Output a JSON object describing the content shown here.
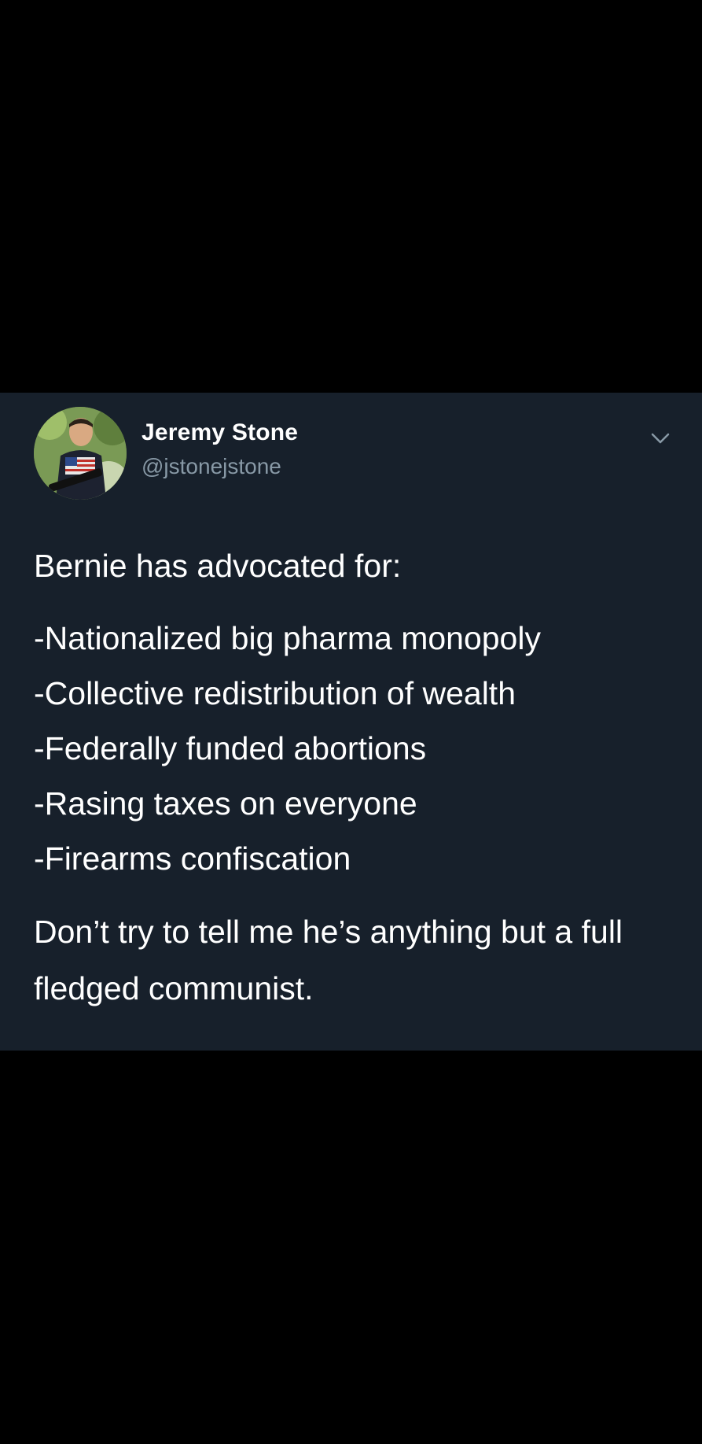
{
  "tweet": {
    "author": {
      "name": "Jeremy Stone",
      "handle": "@jstonejstone"
    },
    "icons": {
      "more": "chevron-down-icon",
      "avatar": "profile-photo"
    },
    "text": {
      "intro": "Bernie has advocated for:",
      "items": [
        "-Nationalized big pharma monopoly",
        "-Collective redistribution of wealth",
        "-Federally funded abortions",
        "-Rasing taxes on everyone",
        "-Firearms confiscation"
      ],
      "closing": "Don’t try to tell me he’s anything but a full fledged communist."
    },
    "colors": {
      "card_background": "#17202b",
      "page_background": "#000000",
      "secondary_text": "#8899a6"
    }
  }
}
